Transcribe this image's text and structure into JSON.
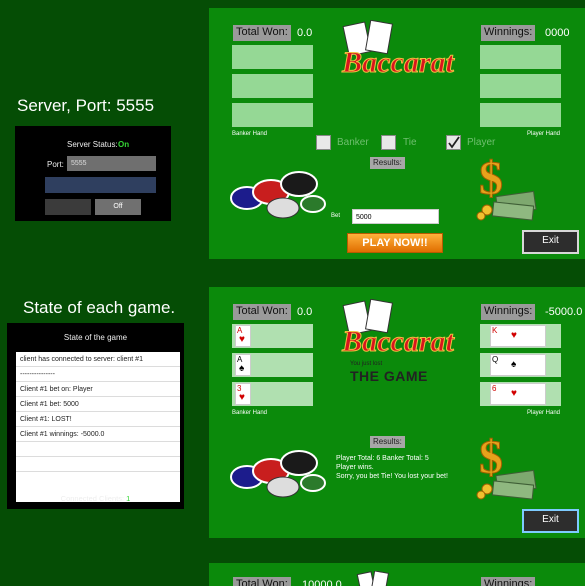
{
  "captions": {
    "server": "Server, Port: 5555",
    "state": "State of each game."
  },
  "server_panel": {
    "status_label": "Server Status:",
    "status_value": "On",
    "port_label": "Port:",
    "port_value": "5555",
    "off_label": "Off"
  },
  "state_panel": {
    "title": "State of the game",
    "log": [
      "client has connected to server: client #1",
      "---------------",
      "Client #1 bet on: Player",
      "Client #1 bet: 5000",
      "Client #1: LOST!",
      "Client #1 winnings: -5000.0",
      "",
      ""
    ],
    "connected_label": "Connected Clients:",
    "connected_count": "1"
  },
  "game1": {
    "total_won_label": "Total Won:",
    "total_won_value": "0.0",
    "winnings_label": "Winnings:",
    "winnings_value": "0000",
    "logo": "Baccarat",
    "banker_hand_label": "Banker Hand",
    "player_hand_label": "Player Hand",
    "options": [
      {
        "label": "Banker",
        "checked": false
      },
      {
        "label": "Tie",
        "checked": false
      },
      {
        "label": "Player",
        "checked": true
      }
    ],
    "results_label": "Results:",
    "bet_label": "Bet",
    "bet_value": "5000",
    "play_label": "PLAY NOW!!",
    "exit_label": "Exit"
  },
  "game2": {
    "total_won_label": "Total Won:",
    "total_won_value": "0.0",
    "winnings_label": "Winnings:",
    "winnings_value": "-5000.0",
    "logo": "Baccarat",
    "banker_hand_label": "Banker Hand",
    "player_hand_label": "Player Hand",
    "banker_cards": [
      {
        "rank": "A",
        "suit": "♥",
        "color": "red"
      },
      {
        "rank": "A",
        "suit": "♠",
        "color": "black"
      },
      {
        "rank": "3",
        "suit": "♥",
        "color": "red"
      }
    ],
    "player_cards": [
      {
        "rank": "K",
        "suit": "♥",
        "color": "red"
      },
      {
        "rank": "Q",
        "suit": "♠",
        "color": "black"
      },
      {
        "rank": "6",
        "suit": "♥",
        "color": "red"
      }
    ],
    "lost_small": "You just lost",
    "lost_big": "THE GAME",
    "results_label": "Results:",
    "result_lines": [
      "Player Total: 6 Banker Total: 5",
      "Player wins.",
      "Sorry, you bet Tie! You lost your bet!"
    ],
    "exit_label": "Exit"
  },
  "game3": {
    "total_won_label": "Total Won:",
    "total_won_value": "10000.0",
    "winnings_label": "Winnings:"
  },
  "colors": {
    "background": "#054d05",
    "table_felt": "#0b8a0b",
    "slot": "#95d895",
    "status_on": "#34d634"
  }
}
